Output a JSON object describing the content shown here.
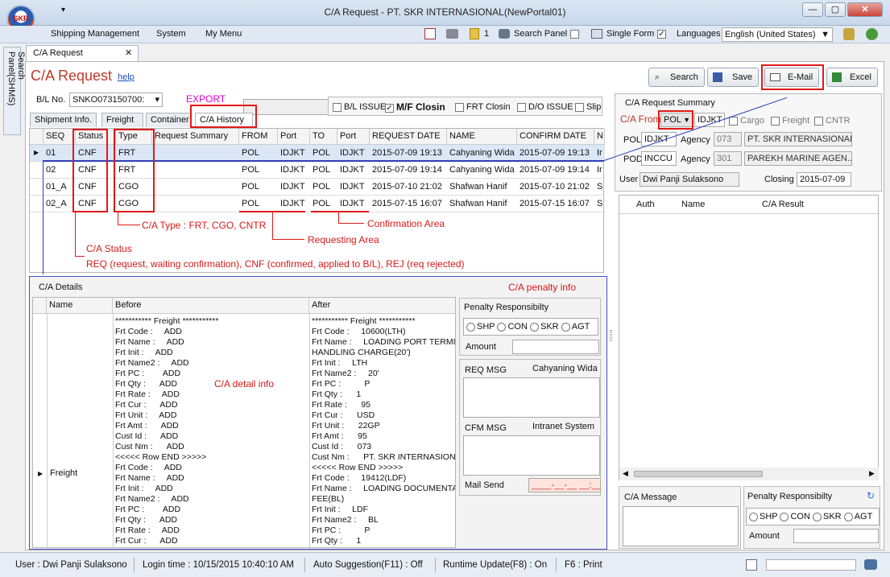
{
  "window": {
    "title": "C/A Request - PT. SKR INTERNASIONAL(NewPortal01)",
    "logo_text": "SKR"
  },
  "menu": [
    "Shipping Management",
    "System",
    "My Menu"
  ],
  "toolbar": {
    "badge_count": "1",
    "search_panel": "Search Panel",
    "single_form": "Single Form",
    "languages_label": "Languages",
    "language_value": "English (United States)"
  },
  "side_tab": "Search Panel(SHMS)",
  "doc_tab": "C/A Request",
  "header": {
    "title": "C/A Request",
    "help": "help"
  },
  "buttons": {
    "search": "Search",
    "save": "Save",
    "email": "E-Mail",
    "excel": "Excel"
  },
  "bl": {
    "label": "B/L No.",
    "value": "SNKO073150700:",
    "export": "EXPORT"
  },
  "flags": {
    "bl_issue": "B/L ISSUE",
    "mf_closing": "M/F Closin",
    "frt_closing": "FRT Closin",
    "do_issue": "D/O ISSUE",
    "slip": "Slip"
  },
  "tabs": [
    "Shipment Info.",
    "Freight",
    "Container",
    "C/A History"
  ],
  "grid": {
    "columns": [
      "SEQ",
      "Status",
      "Type",
      "Request Summary",
      "FROM",
      "Port",
      "TO",
      "Port",
      "REQUEST DATE",
      "NAME",
      "CONFIRM DATE",
      "N"
    ],
    "rows": [
      [
        "01",
        "CNF",
        "FRT",
        "",
        "POL",
        "IDJKT",
        "POL",
        "IDJKT",
        "2015-07-09 19:13",
        "Cahyaning Wida",
        "2015-07-09 19:13",
        "Ir"
      ],
      [
        "02",
        "CNF",
        "FRT",
        "",
        "POL",
        "IDJKT",
        "POL",
        "IDJKT",
        "2015-07-09 19:14",
        "Cahyaning Wida",
        "2015-07-09 19:14",
        "Ir"
      ],
      [
        "01_A",
        "CNF",
        "CGO",
        "",
        "POL",
        "IDJKT",
        "POL",
        "IDJKT",
        "2015-07-10 21:02",
        "Shafwan Hanif",
        "2015-07-10 21:02",
        "S"
      ],
      [
        "02_A",
        "CNF",
        "CGO",
        "",
        "POL",
        "IDJKT",
        "POL",
        "IDJKT",
        "2015-07-15 16:07",
        "Shafwan Hanif",
        "2015-07-15 16:07",
        "S"
      ]
    ]
  },
  "annotations": {
    "ca_type": "C/A Type : FRT, CGO, CNTR",
    "confirmation": "Confirmation Area",
    "requesting": "Requesting Area",
    "ca_status_title": "C/A Status",
    "ca_status_desc": "REQ (request, waiting confirmation), CNF (confirmed, applied to B/L), REJ (req rejected)",
    "penalty": "C/A penalty info",
    "detail": "C/A detail info"
  },
  "details": {
    "title": "C/A Details",
    "columns": [
      "Name",
      "Before",
      "After"
    ],
    "row_name": "Freight",
    "before": "*********** Freight ***********\nFrt Code :     ADD\nFrt Name :     ADD\nFrt Init :     ADD\nFrt Name2 :     ADD\nFrt PC :        ADD\nFrt Qty :      ADD\nFrt Rate :     ADD\nFrt Cur :      ADD\nFrt Unit :     ADD\nFrt Amt :      ADD\nCust Id :      ADD\nCust Nm :      ADD\n<<<<< Row END >>>>>\nFrt Code :     ADD\nFrt Name :     ADD\nFrt Init :     ADD\nFrt Name2 :     ADD\nFrt PC :        ADD\nFrt Qty :      ADD\nFrt Rate :     ADD\nFrt Cur :      ADD",
    "after": "*********** Freight ***********\nFrt Code :     10600(LTH)\nFrt Name :     LOADING PORT TERMIN\nHANDLING CHARGE(20')\nFrt Init :     LTH\nFrt Name2 :     20'\nFrt PC :          P\nFrt Qty :      1\nFrt Rate :      95\nFrt Cur :      USD\nFrt Unit :      22GP\nFrt Amt :      95\nCust Id :      073\nCust Nm :      PT. SKR INTERNASIONA\n<<<<< Row END >>>>>\nFrt Code :     19412(LDF)\nFrt Name :     LOADING DOCUMENTAT\nFEE(BL)\nFrt Init :     LDF\nFrt Name2 :     BL\nFrt PC :          P\nFrt Qty :      1"
  },
  "penalty": {
    "title": "Penalty Responsibilty",
    "options": [
      "SHP",
      "CON",
      "SKR",
      "AGT"
    ],
    "amount_label": "Amount",
    "req_msg": "REQ MSG",
    "req_name": "Cahyaning Wida",
    "cfm_msg": "CFM MSG",
    "cfm_name": "Intranet System",
    "mail_send": "Mail Send",
    "mail_placeholder": "____-__-__ __:__"
  },
  "summary": {
    "title": "C/A Request Summary",
    "ca_from": "C/A From",
    "from_select": "POL",
    "from_port": "IDJKT",
    "cargo": "Cargo",
    "freight": "Freight",
    "cntr": "CNTR",
    "pol_label": "POL",
    "pol_value": "IDJKT",
    "agency_label": "Agency",
    "agency1_code": "073",
    "agency1_name": "PT. SKR INTERNASIONAL",
    "pod_label": "POD",
    "pod_value": "INCCU",
    "agency2_code": "301",
    "agency2_name": "PAREKH MARINE AGEN...",
    "user_label": "User",
    "user_value": "Dwi Panji Sulaksono",
    "closing_label": "Closing",
    "closing_value": "2015-07-09",
    "result_columns": [
      "Auth",
      "Name",
      "C/A Result"
    ],
    "ca_message": "C/A Message",
    "penalty_title": "Penalty Responsibilty",
    "amount_label": "Amount"
  },
  "status": {
    "user": "User : Dwi Panji Sulaksono",
    "login": "Login time : 10/15/2015 10:40:10 AM",
    "auto": "Auto Suggestion(F11) : Off",
    "runtime": "Runtime Update(F8) : On",
    "print": "F6 : Print"
  }
}
